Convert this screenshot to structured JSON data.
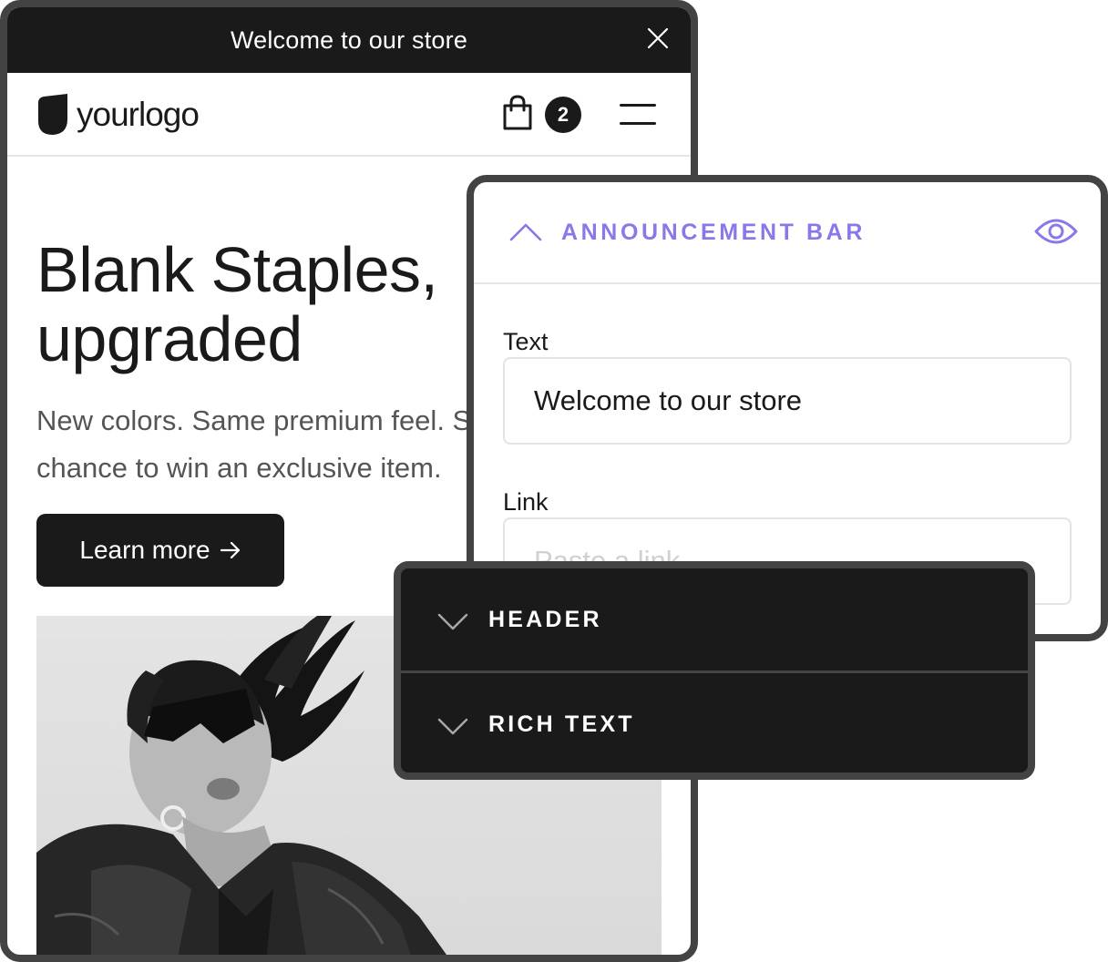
{
  "store": {
    "announcement_text": "Welcome to our store",
    "logo_text": "yourlogo",
    "cart_count": "2",
    "hero_title_line1": "Blank Staples,",
    "hero_title_line2": "upgraded",
    "hero_subtitle": "New colors. Same premium feel. Shop now for a chance to win an exclusive item.",
    "cta_label": "Learn more"
  },
  "editor": {
    "section_title": "ANNOUNCEMENT BAR",
    "text_field_label": "Text",
    "text_field_value": "Welcome to our store",
    "link_field_label": "Link",
    "link_field_placeholder": "Paste a link"
  },
  "sections": [
    {
      "label": "HEADER"
    },
    {
      "label": "RICH TEXT"
    }
  ],
  "colors": {
    "dark": "#1a1a1a",
    "frame": "#434343",
    "accent_purple": "#8b76ea",
    "muted_text": "#555555"
  },
  "icons": {
    "close": "close-icon",
    "logo": "shield-logo-icon",
    "cart": "shopping-bag-icon",
    "menu": "hamburger-menu-icon",
    "arrow": "arrow-right-icon",
    "collapse": "chevron-up-icon",
    "visibility": "eye-icon",
    "expand": "chevron-down-icon"
  }
}
